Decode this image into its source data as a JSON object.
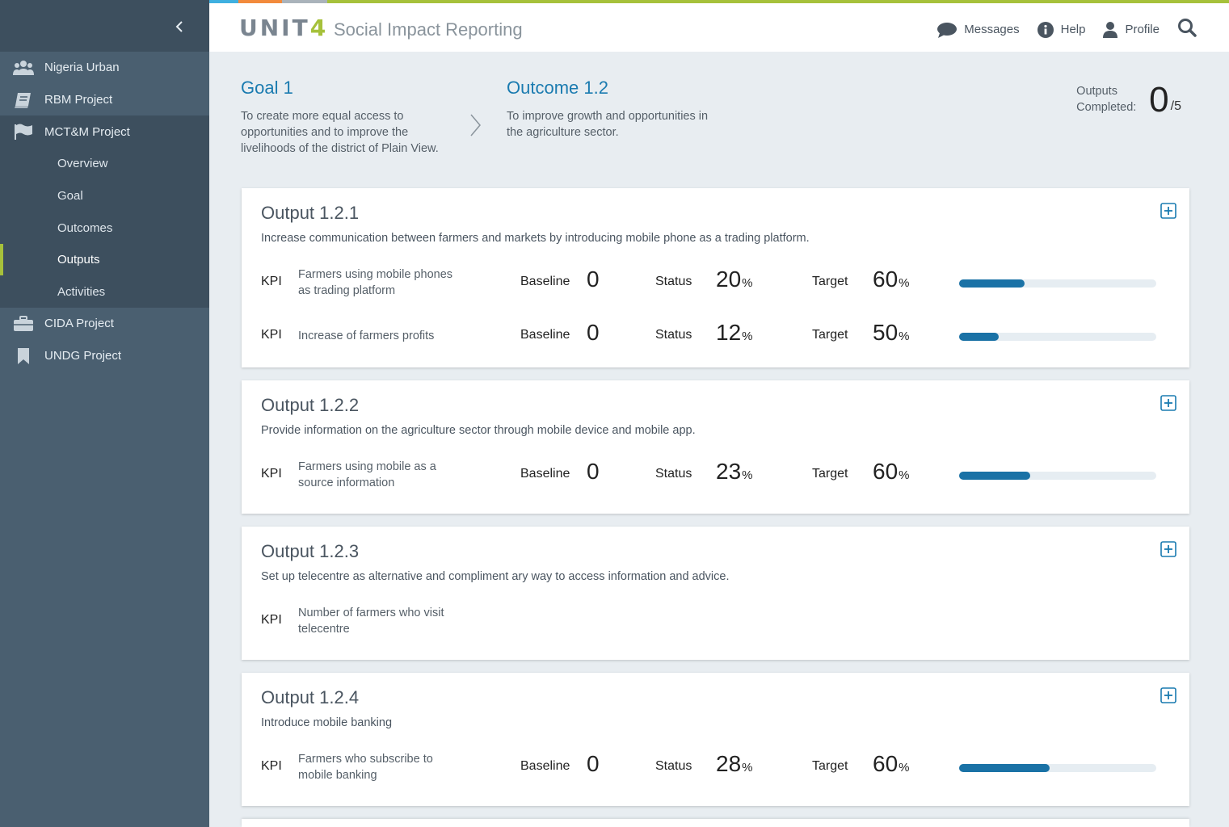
{
  "header": {
    "logo_text": "UNIT",
    "logo_four": "4",
    "title": "Social Impact Reporting",
    "messages": "Messages",
    "help": "Help",
    "profile": "Profile"
  },
  "colors": {
    "accent": "#1a7bb0",
    "brand_green": "#a6c13b",
    "sidebar": "#4a5f70",
    "progress": "#1a72a6"
  },
  "sidebar": {
    "projects": [
      {
        "label": "Nigeria Urban",
        "icon": "people-icon"
      },
      {
        "label": "RBM Project",
        "icon": "book-icon"
      },
      {
        "label": "MCT&M Project",
        "icon": "flag-icon"
      },
      {
        "label": "CIDA Project",
        "icon": "briefcase-icon"
      },
      {
        "label": "UNDG Project",
        "icon": "bookmark-icon"
      }
    ],
    "subnav": [
      "Overview",
      "Goal",
      "Outcomes",
      "Outputs",
      "Activities"
    ],
    "active_sub": "Outputs"
  },
  "breadcrumb": {
    "goal_title": "Goal 1",
    "goal_desc": "To create more equal access to opportunities and to improve the livelihoods of the district of Plain View.",
    "outcome_title": "Outcome 1.2",
    "outcome_desc": "To improve growth and opportunities in the agriculture sector.",
    "outputs_label": "Outputs Completed:",
    "outputs_count": "0",
    "outputs_total": "/5"
  },
  "labels": {
    "kpi": "KPI",
    "baseline": "Baseline",
    "status": "Status",
    "target": "Target",
    "pct": "%"
  },
  "outputs": [
    {
      "title": "Output 1.2.1",
      "desc": "Increase communication between farmers and markets by introducing mobile phone as a trading platform.",
      "kpis": [
        {
          "name": "Farmers using mobile phones as trading platform",
          "baseline": "0",
          "status": "20",
          "target": "60",
          "progress": 0.33
        },
        {
          "name": "Increase of farmers profits",
          "baseline": "0",
          "status": "12",
          "target": "50",
          "progress": 0.2
        }
      ]
    },
    {
      "title": "Output 1.2.2",
      "desc": "Provide information on the agriculture sector through mobile device and mobile app.",
      "kpis": [
        {
          "name": "Farmers using mobile as a source information",
          "baseline": "0",
          "status": "23",
          "target": "60",
          "progress": 0.36
        }
      ]
    },
    {
      "title": "Output 1.2.3",
      "desc": "Set up telecentre as alternative and compliment ary way to access information and advice.",
      "kpis": [
        {
          "name": "Number of farmers who visit telecentre"
        }
      ]
    },
    {
      "title": "Output 1.2.4",
      "desc": "Introduce mobile banking",
      "kpis": [
        {
          "name": "Farmers who subscribe to mobile banking",
          "baseline": "0",
          "status": "28",
          "target": "60",
          "progress": 0.46
        }
      ]
    }
  ]
}
